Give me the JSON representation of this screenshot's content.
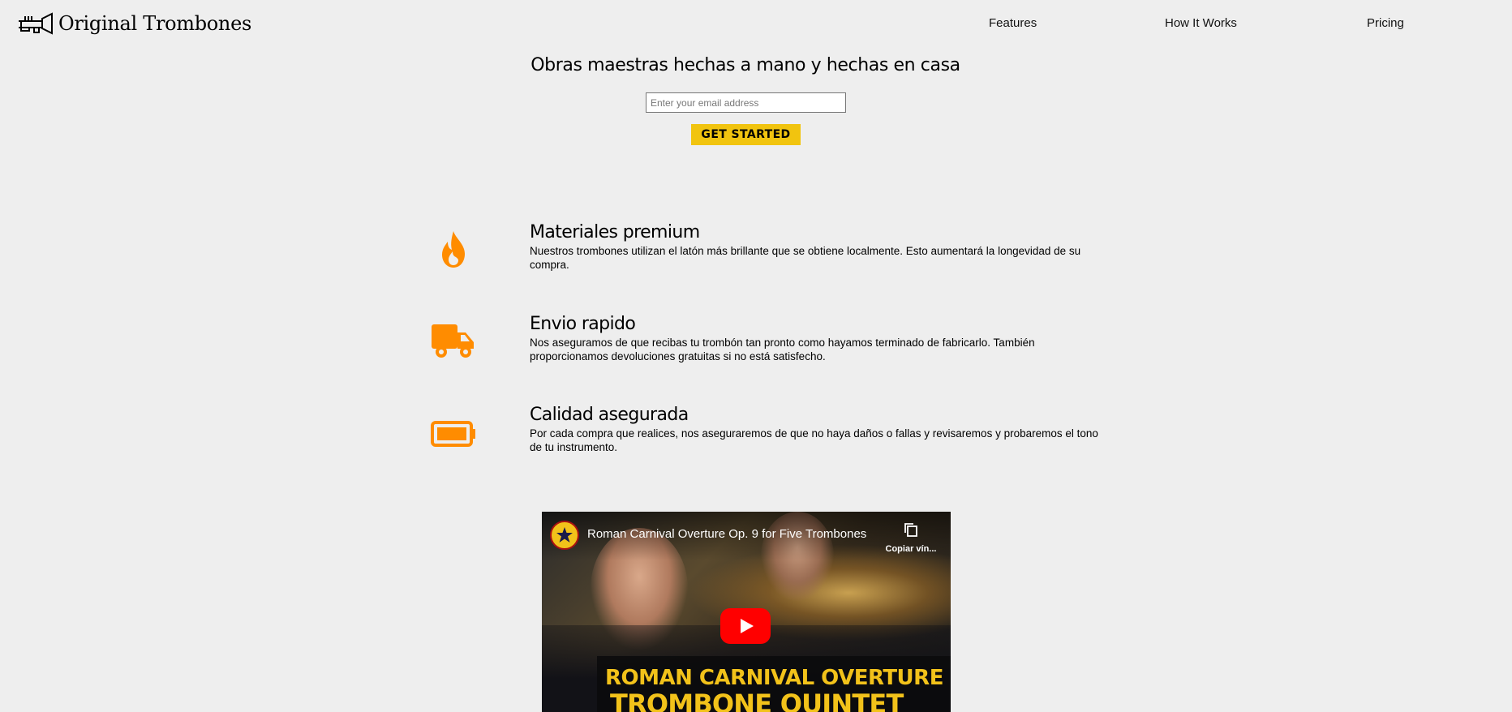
{
  "header": {
    "brand": "Original Trombones",
    "logo_icon": "trombone-icon",
    "nav": [
      {
        "label": "Features"
      },
      {
        "label": "How It Works"
      },
      {
        "label": "Pricing"
      }
    ]
  },
  "hero": {
    "title": "Obras maestras hechas a mano y hechas en casa",
    "email_placeholder": "Enter your email address",
    "email_value": "",
    "cta_label": "GET STARTED"
  },
  "features": [
    {
      "icon": "flame-icon",
      "title": "Materiales premium",
      "description": "Nuestros trombones utilizan el latón más brillante que se obtiene localmente. Esto aumentará la longevidad de su compra."
    },
    {
      "icon": "truck-icon",
      "title": "Envio rapido",
      "description": "Nos aseguramos de que recibas tu trombón tan pronto como hayamos terminado de fabricarlo. También proporcionamos devoluciones gratuitas si no está satisfecho."
    },
    {
      "icon": "battery-icon",
      "title": "Calidad asegurada",
      "description": "Por cada compra que realices, nos aseguraremos de que no haya daños o fallas y revisaremos y probaremos el tono de tu instrumento."
    }
  ],
  "video": {
    "title": "Roman Carnival Overture Op. 9 for Five Trombones",
    "copy_label": "Copiar vín...",
    "banner_line1": "ROMAN CARNIVAL OVERTURE",
    "banner_line2": "TROMBONE QUINTET",
    "play_icon": "play-icon"
  },
  "colors": {
    "background": "#eeeeee",
    "accent_orange": "#ff8c00",
    "cta_yellow": "#f1c40f",
    "youtube_red": "#ff0000"
  }
}
